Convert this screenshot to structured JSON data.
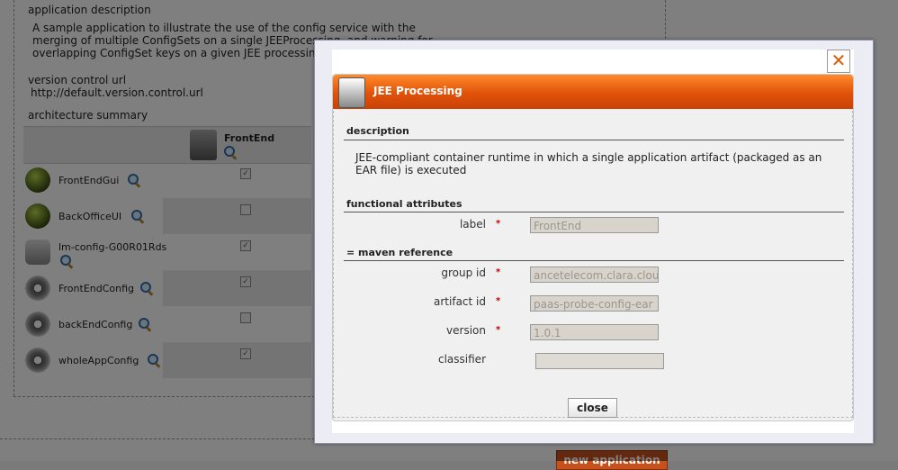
{
  "background": {
    "app_description_label": "application description",
    "app_description": "A sample application to illustrate the use of the config service with the merging of multiple ConfigSets on a single JEEProcessing, and warning for overlapping ConfigSet keys on a given JEE processing",
    "version_control_label": "version control url",
    "version_control_url": "http://default.version.control.url",
    "architecture_label": "architecture summary",
    "column_header": "FrontEnd",
    "rows": [
      {
        "label": "FrontEndGui",
        "icon": "globe-icon",
        "checked": true
      },
      {
        "label": "BackOfficeUI",
        "icon": "globe-icon",
        "checked": false
      },
      {
        "label": "lm-config-G00R01Rds",
        "icon": "database-icon",
        "checked": true
      },
      {
        "label": "FrontEndConfig",
        "icon": "gear-icon",
        "checked": true
      },
      {
        "label": "backEndConfig",
        "icon": "gear-icon",
        "checked": false
      },
      {
        "label": "wholeAppConfig",
        "icon": "gear-icon",
        "checked": true
      }
    ],
    "new_app_button": "new application"
  },
  "modal": {
    "close_icon": "✕",
    "title": "JEE Processing",
    "description_section": "description",
    "description_text": "JEE-compliant container runtime in which a single application artifact (packaged as an EAR file) is executed",
    "functional_section": "functional attributes",
    "label_field": {
      "label": "label",
      "required": "*",
      "value": "FrontEnd"
    },
    "maven_section": "= maven reference",
    "group_id": {
      "label": "group id",
      "required": "*",
      "value": "ancetelecom.clara.cloud"
    },
    "artifact_id": {
      "label": "artifact id",
      "required": "*",
      "value": "paas-probe-config-ear"
    },
    "version": {
      "label": "version",
      "required": "*",
      "value": "1.0.1"
    },
    "classifier": {
      "label": "classifier",
      "value": ""
    },
    "close_button": "close"
  },
  "colors": {
    "header_orange": "#e0520a",
    "required_red": "#cc0000",
    "close_x_orange": "#e05a00"
  }
}
